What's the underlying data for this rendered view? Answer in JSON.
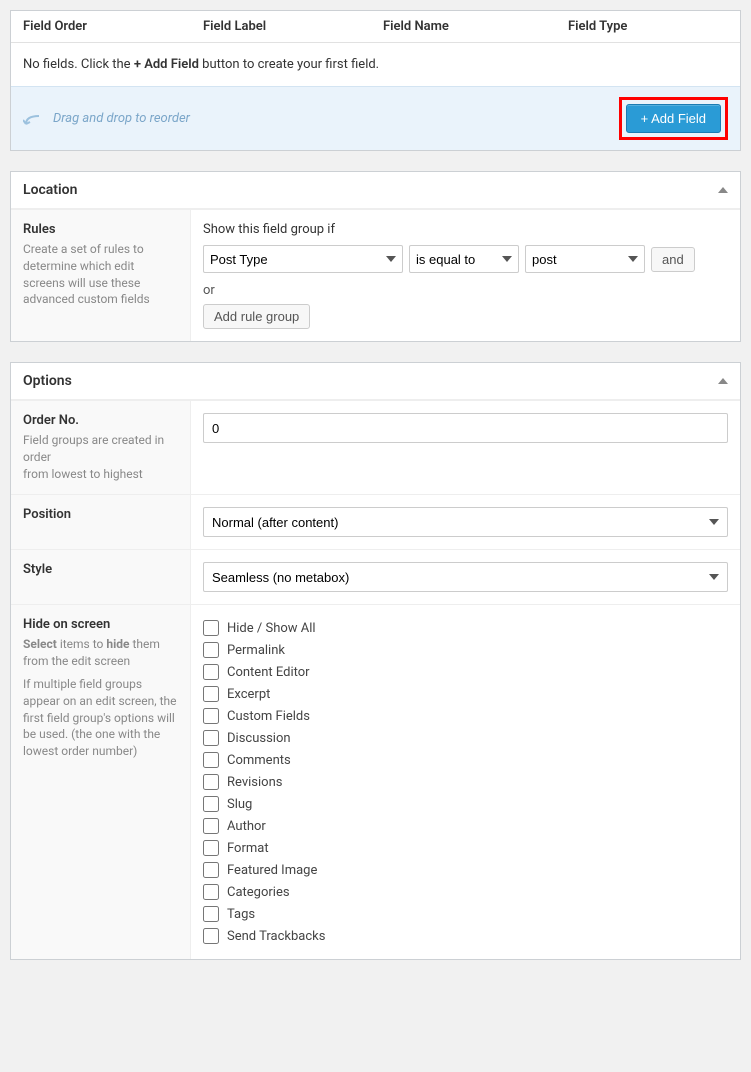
{
  "fields_table": {
    "headers": {
      "order": "Field Order",
      "label": "Field Label",
      "name": "Field Name",
      "type": "Field Type"
    },
    "empty_pre": "No fields. Click the ",
    "empty_bold": "+ Add Field",
    "empty_post": " button to create your first field.",
    "reorder_hint": "Drag and drop to reorder",
    "add_button": "+ Add Field"
  },
  "location": {
    "title": "Location",
    "rules_label": "Rules",
    "rules_desc": "Create a set of rules to determine which edit screens will use these advanced custom fields",
    "show_if_label": "Show this field group if",
    "param": "Post Type",
    "operator": "is equal to",
    "value": "post",
    "and_button": "and",
    "or_label": "or",
    "add_rule_group": "Add rule group"
  },
  "options": {
    "title": "Options",
    "order_no": {
      "label": "Order No.",
      "desc_1": "Field groups are created in order",
      "desc_2": "from lowest to highest",
      "value": "0"
    },
    "position": {
      "label": "Position",
      "value": "Normal (after content)"
    },
    "style": {
      "label": "Style",
      "value": "Seamless (no metabox)"
    },
    "hide": {
      "label": "Hide on screen",
      "desc_1a": "Select",
      "desc_1b": " items to ",
      "desc_1c": "hide",
      "desc_1d": " them from the edit screen",
      "desc_2": "If multiple field groups appear on an edit screen, the first field group's options will be used. (the one with the lowest order number)",
      "items": [
        "Hide / Show All",
        "Permalink",
        "Content Editor",
        "Excerpt",
        "Custom Fields",
        "Discussion",
        "Comments",
        "Revisions",
        "Slug",
        "Author",
        "Format",
        "Featured Image",
        "Categories",
        "Tags",
        "Send Trackbacks"
      ]
    }
  }
}
